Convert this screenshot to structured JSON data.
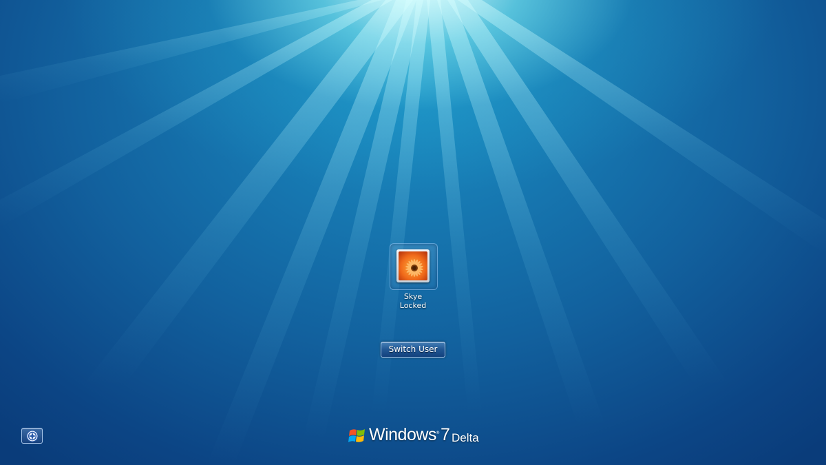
{
  "user": {
    "name": "Skye",
    "status": "Locked"
  },
  "actions": {
    "switch_user_label": "Switch User"
  },
  "branding": {
    "windows": "Windows",
    "trademark": "®",
    "version": "7",
    "edition": "Delta"
  },
  "icons": {
    "avatar": "flower-avatar-icon",
    "ease_of_access": "ease-of-access-icon",
    "logo": "windows-flag-icon"
  },
  "colors": {
    "background_top": "#bff4f8",
    "background_mid": "#12619e",
    "background_bottom": "#0a3c7a",
    "text": "#ffffff"
  }
}
